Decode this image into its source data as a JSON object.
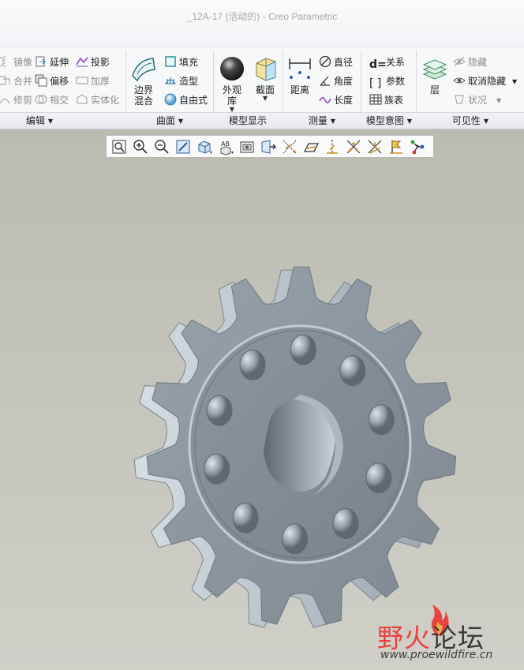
{
  "window": {
    "title": "_12A-17 (活动的) - Creo Parametric"
  },
  "ribbon": {
    "edit": {
      "mirror": "镜像",
      "merge": "合并",
      "trim": "修剪",
      "extend": "延伸",
      "offset": "偏移",
      "intersect": "相交",
      "project": "投影",
      "thicken": "加厚",
      "solidify": "实体化"
    },
    "surfaces": {
      "boundary_blend": "边界\n混合",
      "fill": "填充",
      "style": "造型",
      "freestyle": "自由式"
    },
    "model_display": {
      "appearance_gallery": "外观\n库",
      "section": "截面"
    },
    "measure": {
      "distance": "距离",
      "diameter": "直径",
      "angle": "角度",
      "length": "长度"
    },
    "model_intent": {
      "relations": "关系",
      "parameters": "参数",
      "family_table": "族表"
    },
    "visibility": {
      "layers": "层",
      "hide": "隐藏",
      "unhide": "取消隐藏",
      "status": "状况"
    }
  },
  "group_tabs": [
    "编辑",
    "曲面",
    "模型显示",
    "测量",
    "模型意图",
    "可见性"
  ],
  "view_toolbar": [
    "refit-icon",
    "zoom-in-icon",
    "zoom-out-icon",
    "repaint-icon",
    "display-style-icon",
    "saved-orientations-icon",
    "view-manager-icon",
    "perspective-view-icon",
    "datum-display-icon",
    "plane-display-icon",
    "axis-display-icon",
    "point-display-icon",
    "csys-display-icon",
    "annotation-display-icon",
    "spin-center-icon"
  ],
  "model": {
    "type": "sprocket",
    "teeth": 15,
    "bolt_holes": 10
  },
  "watermark": {
    "logo_text_1": "野火",
    "logo_text_2": "论坛",
    "url": "www.proewildfire.cn"
  },
  "colors": {
    "model": "#8a939c",
    "background_top": "#babbb1",
    "background_bottom": "#d0cfc8",
    "watermark_red": "#e8433f"
  }
}
